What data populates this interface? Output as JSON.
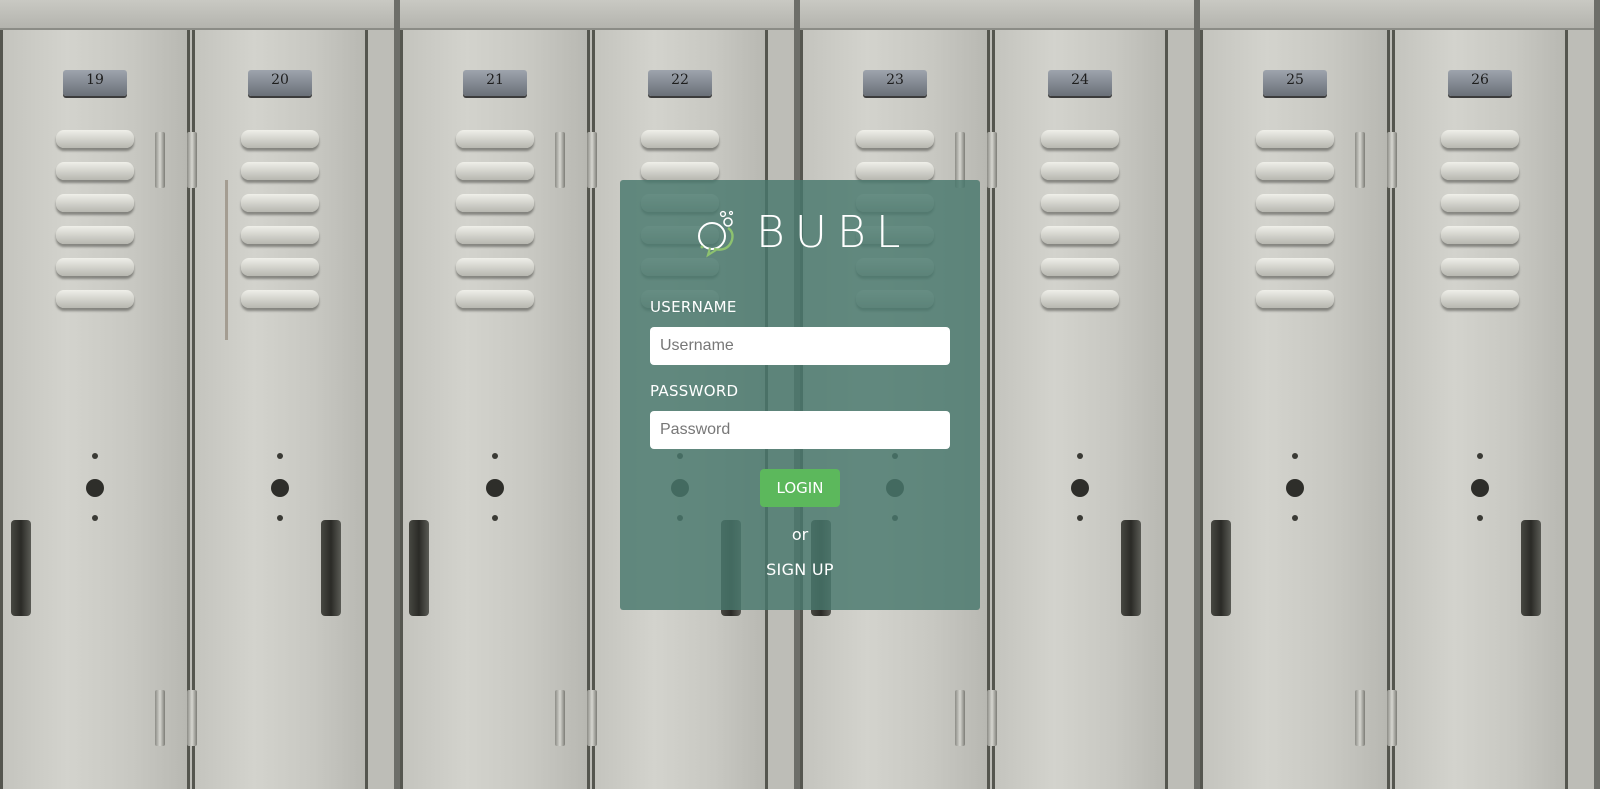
{
  "background": {
    "locker_numbers": [
      "19",
      "20",
      "21",
      "22",
      "23",
      "24",
      "25",
      "26"
    ]
  },
  "brand": {
    "name": "BUBL",
    "icon": "speech-bubble-icon",
    "accent_color": "#8dc26f"
  },
  "form": {
    "username_label": "USERNAME",
    "username_placeholder": "Username",
    "username_value": "",
    "password_label": "PASSWORD",
    "password_placeholder": "Password",
    "password_value": "",
    "login_label": "LOGIN",
    "or_text": "or",
    "signup_label": "SIGN UP"
  },
  "colors": {
    "panel": "#48786c",
    "login_button": "#5cb85c",
    "text": "#ffffff"
  }
}
